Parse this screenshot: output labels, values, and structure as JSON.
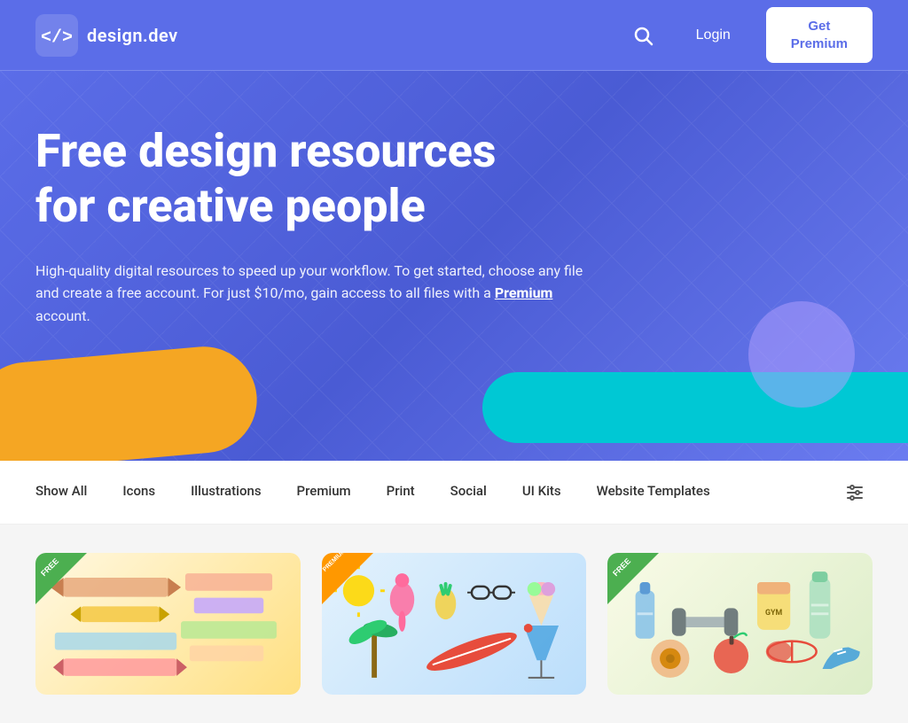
{
  "site": {
    "logo_text": "design.dev",
    "logo_icon_alt": "code-icon"
  },
  "header": {
    "login_label": "Login",
    "premium_line1": "Get",
    "premium_line2": "Premium",
    "premium_label": "Get\nPremium"
  },
  "hero": {
    "title_line1": "Free design resources",
    "title_line2": "for creative people",
    "description": "High-quality digital resources to speed up your workflow. To get started, choose any file and create a free account. For just $10/mo, gain access to all files with a",
    "description_link": "Premium",
    "description_end": " account."
  },
  "filter": {
    "items": [
      {
        "label": "Show All",
        "id": "show-all"
      },
      {
        "label": "Icons",
        "id": "icons"
      },
      {
        "label": "Illustrations",
        "id": "illustrations"
      },
      {
        "label": "Premium",
        "id": "premium"
      },
      {
        "label": "Print",
        "id": "print"
      },
      {
        "label": "Social",
        "id": "social"
      },
      {
        "label": "UI Kits",
        "id": "ui-kits"
      },
      {
        "label": "Website Templates",
        "id": "website-templates"
      }
    ],
    "settings_icon": "sliders-icon"
  },
  "cards": [
    {
      "badge": "FREE",
      "badge_type": "free",
      "id": "card-banners"
    },
    {
      "badge": "PREMIUM",
      "badge_type": "premium",
      "id": "card-summer"
    },
    {
      "badge": "FREE",
      "badge_type": "free",
      "id": "card-tools"
    }
  ],
  "colors": {
    "accent": "#5b6de8",
    "orange_blob": "#f5a623",
    "teal_blob": "#00c8d4",
    "premium_btn_bg": "white",
    "premium_btn_text": "#5b6de8"
  }
}
